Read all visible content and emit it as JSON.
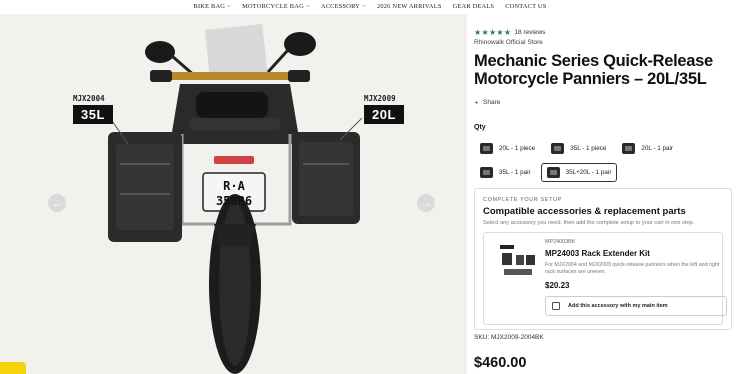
{
  "nav": {
    "items": [
      {
        "label": "BIKE BAG",
        "has_dropdown": true
      },
      {
        "label": "MOTORCYCLE BAG",
        "has_dropdown": true
      },
      {
        "label": "ACCESSORY",
        "has_dropdown": true
      },
      {
        "label": "2026 NEW ARRIVALS",
        "has_dropdown": false
      },
      {
        "label": "GEAR DEALS",
        "has_dropdown": false
      },
      {
        "label": "CONTACT US",
        "has_dropdown": false
      }
    ]
  },
  "gallery": {
    "left_tag": {
      "code": "MJX2004",
      "size": "35L"
    },
    "right_tag": {
      "code": "MJX2009",
      "size": "20L"
    },
    "plate_line1": "R·A",
    "plate_line2": "358R6"
  },
  "product": {
    "stars": "★★★★★",
    "reviews": "18 reviews",
    "seller": "Rhinowalk Official Store",
    "title": "Mechanic Series Quick-Release Motorcycle Panniers – 20L/35L",
    "share_label": "Share",
    "qty_label": "Qty",
    "qty_options": [
      {
        "label": "20L - 1 piece",
        "selected": false
      },
      {
        "label": "35L - 1 piece",
        "selected": false
      },
      {
        "label": "20L - 1 pair",
        "selected": false
      },
      {
        "label": "35L - 1 pair",
        "selected": false
      },
      {
        "label": "35L+20L - 1 pair",
        "selected": true
      }
    ],
    "sku": "SKU: MJX2009-2004BK",
    "price": "$460.00"
  },
  "accessories": {
    "eyebrow": "COMPLETE YOUR SETUP",
    "heading": "Compatible accessories & replacement parts",
    "description": "Select any accessory you need, then add the complete setup to your cart in one step.",
    "item": {
      "sku": "MP24003BK",
      "name": "MP24003 Rack Extender Kit",
      "text": "For MJX2004 and MJX2009 quick-release panniers when the left and right rack surfaces are uneven.",
      "price": "$20.23",
      "add_label": "Add this accessory with my main item"
    }
  },
  "colors": {
    "star": "#2e7d4f",
    "background_gallery": "#f3f1ee",
    "tab": "#f5d20a"
  }
}
